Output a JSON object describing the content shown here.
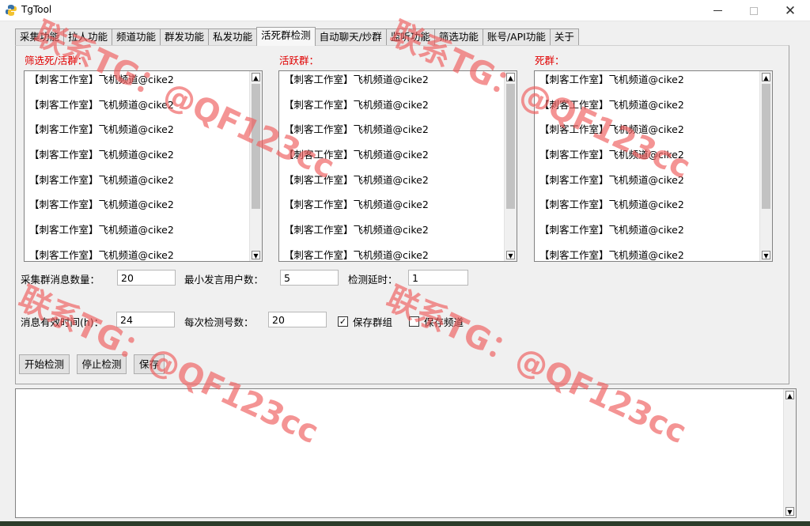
{
  "window": {
    "title": "TgTool",
    "minimize_icon": "minimize-icon",
    "maximize_icon": "maximize-icon",
    "close_icon": "close-icon",
    "close_glyph": "✕"
  },
  "tabs": [
    {
      "label": "采集功能"
    },
    {
      "label": "拉人功能"
    },
    {
      "label": "频道功能"
    },
    {
      "label": "群发功能"
    },
    {
      "label": "私发功能"
    },
    {
      "label": "活死群检测"
    },
    {
      "label": "自动聊天/炒群"
    },
    {
      "label": "监听功能"
    },
    {
      "label": "筛选功能"
    },
    {
      "label": "账号/API功能"
    },
    {
      "label": "关于"
    }
  ],
  "active_tab": "活死群检测",
  "lists": {
    "filter": {
      "label": "筛选死/活群：",
      "items": [
        "【刺客工作室】飞机频道@cike2",
        "【刺客工作室】飞机频道@cike2",
        "【刺客工作室】飞机频道@cike2",
        "【刺客工作室】飞机频道@cike2",
        "【刺客工作室】飞机频道@cike2",
        "【刺客工作室】飞机频道@cike2",
        "【刺客工作室】飞机频道@cike2",
        "【刺客工作室】飞机频道@cike2"
      ]
    },
    "active": {
      "label": "活跃群：",
      "items": [
        "【刺客工作室】飞机频道@cike2",
        "【刺客工作室】飞机频道@cike2",
        "【刺客工作室】飞机频道@cike2",
        "【刺客工作室】飞机频道@cike2",
        "【刺客工作室】飞机频道@cike2",
        "【刺客工作室】飞机频道@cike2",
        "【刺客工作室】飞机频道@cike2",
        "【刺客工作室】飞机频道@cike2"
      ]
    },
    "dead": {
      "label": "死群：",
      "items": [
        "【刺客工作室】飞机频道@cike2",
        "【刺客工作室】飞机频道@cike2",
        "【刺客工作室】飞机频道@cike2",
        "【刺客工作室】飞机频道@cike2",
        "【刺客工作室】飞机频道@cike2",
        "【刺客工作室】飞机频道@cike2",
        "【刺客工作室】飞机频道@cike2",
        "【刺客工作室】飞机频道@cike2"
      ]
    }
  },
  "settings": {
    "collect_msg_count": {
      "label": "采集群消息数量：",
      "value": "20"
    },
    "min_speakers": {
      "label": "最小发言用户数：",
      "value": "5"
    },
    "detect_delay": {
      "label": "检测延时：",
      "value": "1"
    },
    "msg_valid_time": {
      "label": "消息有效时间(h)：",
      "value": "24"
    },
    "per_detect_accounts": {
      "label": "每次检测号数：",
      "value": "20"
    },
    "save_groups": {
      "label": "保存群组",
      "checked": true
    },
    "save_channels": {
      "label": "保存频道",
      "checked": false
    }
  },
  "buttons": {
    "start": "开始检测",
    "stop": "停止检测",
    "save": "保存"
  },
  "check_glyph": "✓",
  "scroll_up_glyph": "▲",
  "scroll_down_glyph": "▼",
  "watermark_text": "联系TG：@QF123cc",
  "colors": {
    "label_red": "#e00000",
    "watermark": "#ee5a5a"
  }
}
